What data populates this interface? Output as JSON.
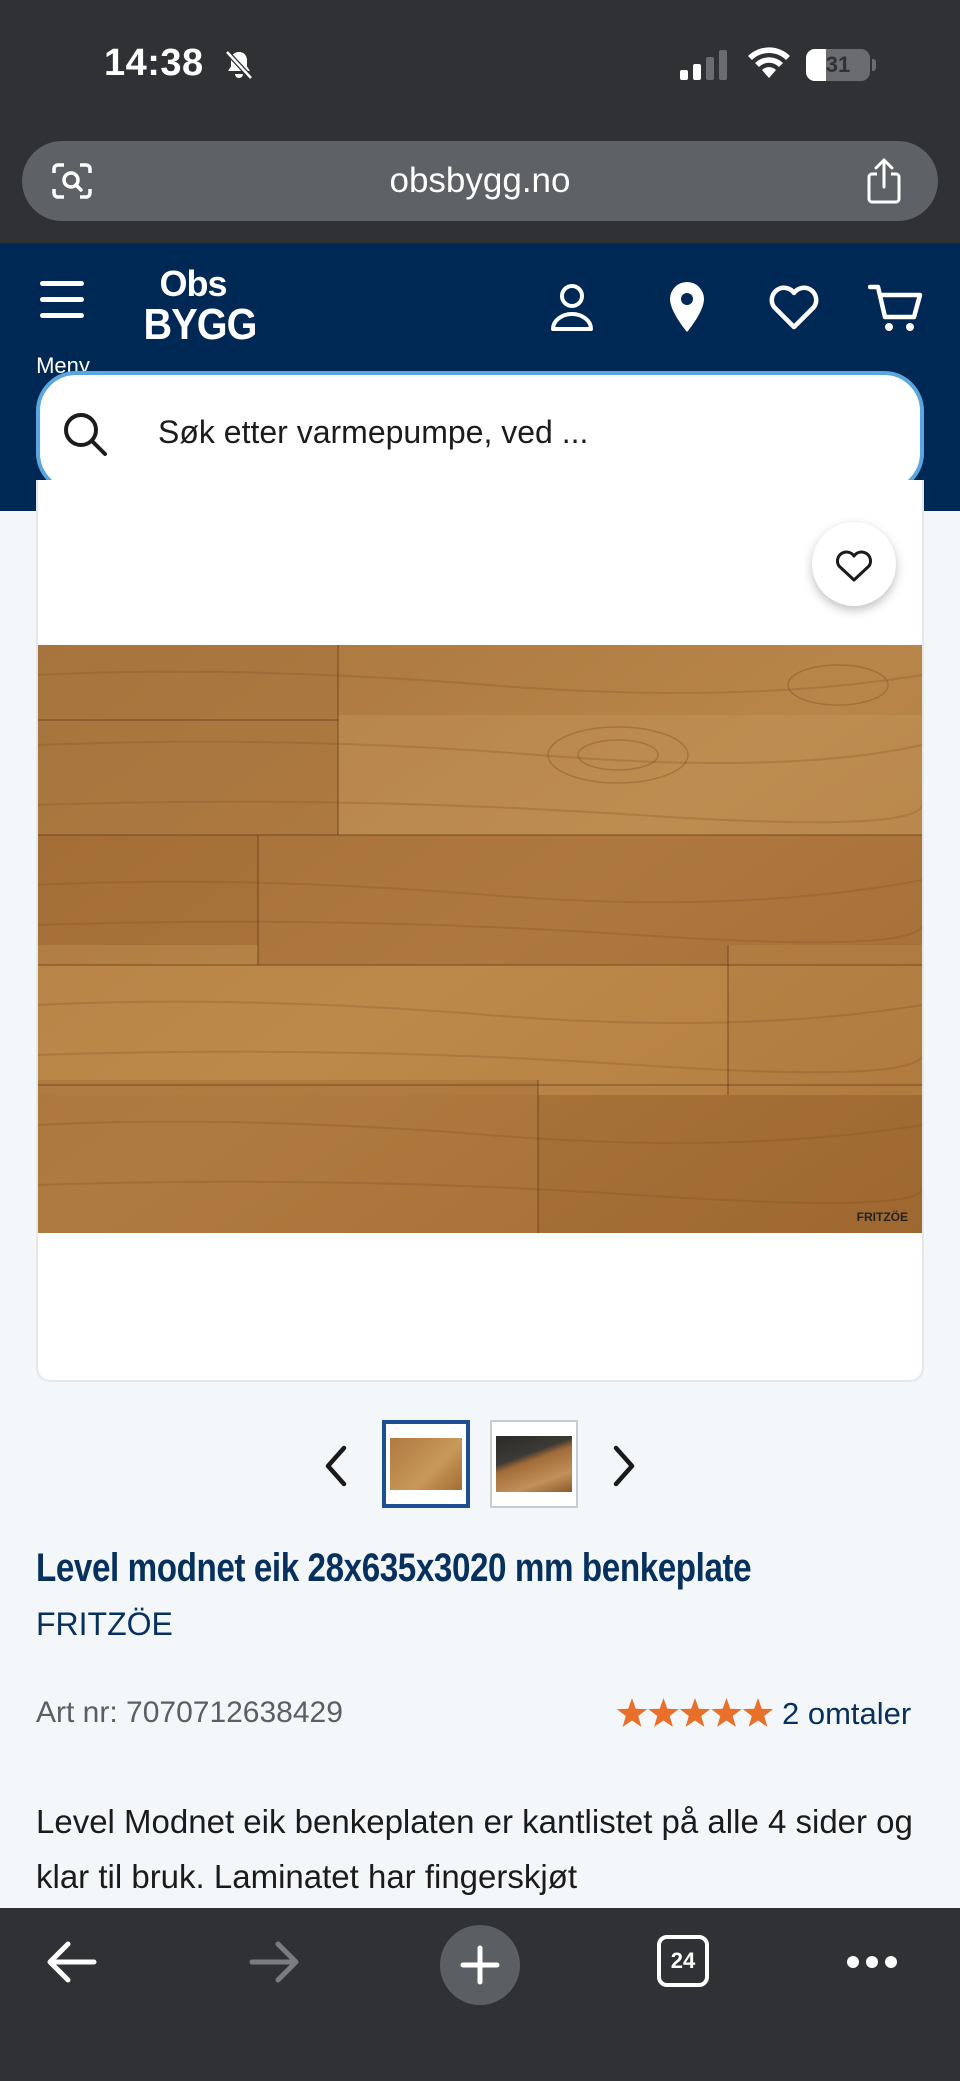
{
  "status_bar": {
    "time": "14:38",
    "battery": "31",
    "battery_level": 0.31
  },
  "browser": {
    "url": "obsbygg.no",
    "tab_count": "24"
  },
  "header": {
    "menu_label": "Meny",
    "logo_top": "Obs",
    "logo_bottom": "BYGG",
    "search_placeholder": "Søk etter varmepumpe, ved ..."
  },
  "product": {
    "watermark_brand": "FRITZÖE",
    "title": "Level modnet eik 28x635x3020 mm benkeplate",
    "brand": "FRITZÖE",
    "art_nr": "Art nr: 7070712638429",
    "rating_stars": 5,
    "reviews": "2 omtaler",
    "description": "Level Modnet eik benkeplaten er kantlistet på alle 4 sider og klar til bruk. Laminatet har fingerskjøt"
  },
  "colors": {
    "header_bg": "#002855",
    "brand_text": "#06305e",
    "star": "#e8702a",
    "search_border": "#5aa6de"
  }
}
